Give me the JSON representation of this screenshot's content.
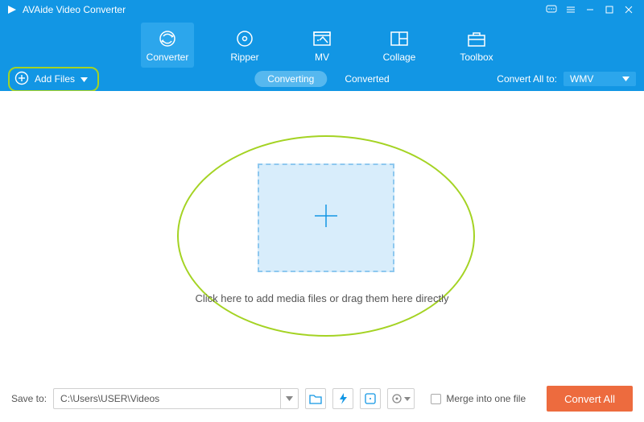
{
  "app": {
    "title": "AVAide Video Converter"
  },
  "tabs": {
    "converter": "Converter",
    "ripper": "Ripper",
    "mv": "MV",
    "collage": "Collage",
    "toolbox": "Toolbox"
  },
  "subbar": {
    "add_files": "Add Files",
    "converting": "Converting",
    "converted": "Converted",
    "convert_all_to": "Convert All to:",
    "format": "WMV"
  },
  "dropzone": {
    "hint": "Click here to add media files or drag them here directly"
  },
  "footer": {
    "save_to_label": "Save to:",
    "save_path": "C:\\Users\\USER\\Videos",
    "merge_label": "Merge into one file",
    "convert_all_btn": "Convert All"
  }
}
